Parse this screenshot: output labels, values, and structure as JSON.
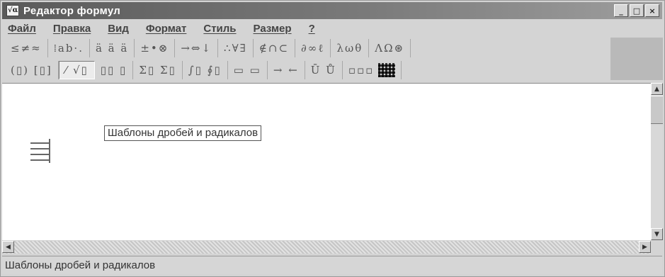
{
  "window": {
    "title": "Редактор формул"
  },
  "menu": {
    "items": [
      "Файл",
      "Правка",
      "Вид",
      "Формат",
      "Стиль",
      "Размер",
      "?"
    ]
  },
  "toolbar": {
    "row1": [
      "≤≠≈",
      "⁞ab·.",
      "ä ä ä",
      "±•⊗",
      "→⇔↓",
      "∴∀∃",
      "∉∩⊂",
      "∂∞ℓ",
      "λωθ",
      "ΛΩ⊛"
    ],
    "row2": [
      "(▯) [▯]",
      "⁄ √▯",
      "▯▯ ▯",
      "Σ▯ Σ▯",
      "∫▯ ∮▯",
      "▭ ▭",
      "→ ←",
      "Ū Ů",
      "▫▫▫"
    ]
  },
  "editor": {
    "tooltip": "Шаблоны дробей и радикалов"
  },
  "icons": {
    "app": "formula-editor-icon",
    "grid": "matrix-grid-icon"
  },
  "status": {
    "text": "Шаблоны дробей и радикалов"
  }
}
